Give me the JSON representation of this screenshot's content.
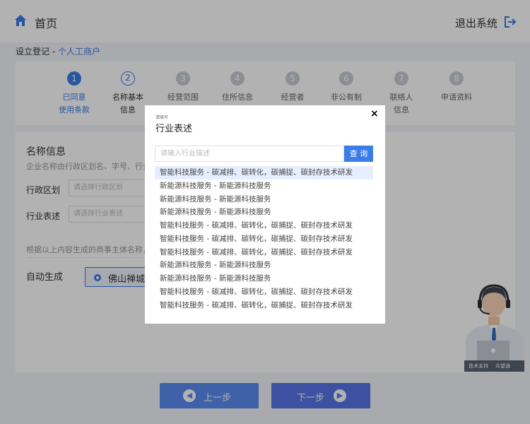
{
  "header": {
    "home_label": "首页",
    "logout_label": "退出系统"
  },
  "breadcrumb": {
    "prefix": "设立登记 - ",
    "link": "个人工商户"
  },
  "steps": [
    {
      "num": "1",
      "line1": "已同意",
      "line2": "使用条款",
      "state": "done"
    },
    {
      "num": "2",
      "line1": "名称基本",
      "line2": "信息",
      "state": "active"
    },
    {
      "num": "3",
      "line1": "经营范围",
      "line2": "",
      "state": "todo"
    },
    {
      "num": "4",
      "line1": "住所信息",
      "line2": "",
      "state": "todo"
    },
    {
      "num": "5",
      "line1": "经营者",
      "line2": "",
      "state": "todo"
    },
    {
      "num": "6",
      "line1": "非公有制",
      "line2": "",
      "state": "todo"
    },
    {
      "num": "7",
      "line1": "联络人",
      "line2": "信息",
      "state": "todo"
    },
    {
      "num": "8",
      "line1": "申请资料",
      "line2": "",
      "state": "todo"
    }
  ],
  "form": {
    "section_title": "名称信息",
    "section_desc": "企业名称由行政区划名、字号、行业",
    "region_label": "行政区划",
    "region_placeholder": "请选择行政区划",
    "industry_label": "行业表述",
    "industry_placeholder": "请选择行业表述",
    "hint": "根据以上内容生成的商事主体名称，",
    "auto_label": "自动生成",
    "auto_option": "佛山禅城"
  },
  "buttons": {
    "prev": "上一步",
    "next": "下一步"
  },
  "support": {
    "left": "技术支持",
    "right": "众望通"
  },
  "modal": {
    "subtitle": "请填写",
    "title": "行业表述",
    "close": "×",
    "search_placeholder": "请输入行业描述",
    "search_button": "查 询",
    "results": [
      "智能科技服务 - 碳减排、碳转化，碳捕捉、碳封存技术研发",
      "新能源科技服务 - 新能源科技服务",
      "新能源科技服务 - 新能源科技服务",
      "新能源科技服务 - 新能源科技服务",
      "智能科技服务 - 碳减排、碳转化，碳捕捉、碳封存技术研发",
      "智能科技服务 - 碳减排、碳转化，碳捕捉、碳封存技术研发",
      "智能科技服务 - 碳减排、碳转化，碳捕捉、碳封存技术研发",
      "新能源科技服务 - 新能源科技服务",
      "新能源科技服务 - 新能源科技服务",
      "智能科技服务 - 碳减排、碳转化，碳捕捉、碳封存技术研发",
      "智能科技服务 - 碳减排、碳转化，碳捕捉、碳封存技术研发"
    ]
  },
  "colors": {
    "accent": "#3a7de8",
    "button": "#5b8cf0",
    "overlay": "rgba(0,0,0,0.3)"
  }
}
